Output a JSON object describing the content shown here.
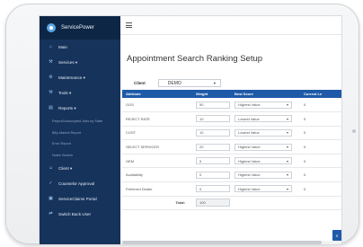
{
  "app": {
    "brand_name": "ServicePower"
  },
  "sidebar": {
    "items": [
      {
        "label": "Main",
        "icon": "home-icon",
        "type": "main"
      },
      {
        "label": "Services ▾",
        "icon": "wrench-icon",
        "type": "main"
      },
      {
        "label": "Maintenance ▾",
        "icon": "gear-icon",
        "type": "main"
      },
      {
        "label": "Tools ▾",
        "icon": "tools-icon",
        "type": "main"
      },
      {
        "label": "Reports ▾",
        "icon": "chart-icon",
        "type": "main"
      },
      {
        "label": "Reject/Unaccepted Jobs by State",
        "type": "sub"
      },
      {
        "label": "Billy Market Report",
        "type": "sub"
      },
      {
        "label": "Error Report",
        "type": "sub"
      },
      {
        "label": "Notes Search",
        "type": "sub"
      },
      {
        "label": "Client ▾",
        "icon": "user-icon",
        "type": "main"
      },
      {
        "label": "Counselor Approval",
        "icon": "check-icon",
        "type": "main"
      },
      {
        "label": "ServiceClaims Portal",
        "icon": "portal-icon",
        "type": "main"
      },
      {
        "label": "Switch Back User",
        "icon": "switch-icon",
        "type": "main"
      }
    ]
  },
  "main": {
    "title": "Appointment Search Ranking Setup",
    "client": {
      "label": "Client",
      "value": "DEMO"
    },
    "table": {
      "headers": [
        "Attribute",
        "Weight",
        "Best Score",
        "Current Le"
      ],
      "rows": [
        {
          "attribute": "GOS",
          "weight": "50",
          "best_score": "Highest Value",
          "current": "0"
        },
        {
          "attribute": "REJECT RATE",
          "weight": "10",
          "best_score": "Lowest Value",
          "current": "0"
        },
        {
          "attribute": "COST",
          "weight": "10",
          "best_score": "Lowest Value",
          "current": "0"
        },
        {
          "attribute": "SELECT SERVICER",
          "weight": "20",
          "best_score": "Highest Value",
          "current": "0"
        },
        {
          "attribute": "OEM",
          "weight": "5",
          "best_score": "Highest Value",
          "current": "0"
        },
        {
          "attribute": "Availability",
          "weight": "0",
          "best_score": "Highest Value",
          "current": "0"
        },
        {
          "attribute": "Preferred Dealer",
          "weight": "0",
          "best_score": "Highest Value",
          "current": "0"
        }
      ],
      "total_label": "Total:",
      "total_value": "100"
    },
    "save_label": "S"
  }
}
